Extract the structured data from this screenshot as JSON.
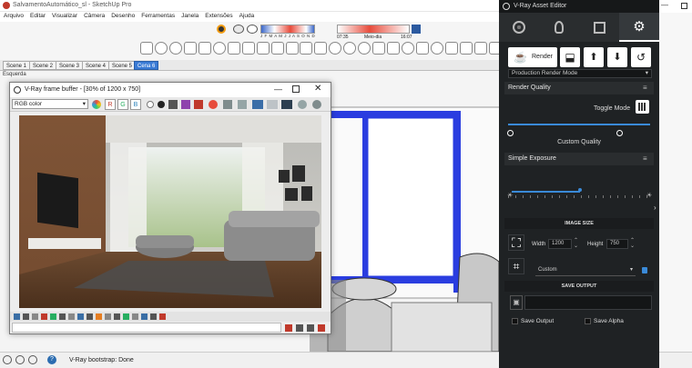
{
  "sketchup": {
    "title": "SalvamentoAutomático_sl - SketchUp Pro",
    "menu": [
      "Arquivo",
      "Editar",
      "Visualizar",
      "Câmera",
      "Desenho",
      "Ferramentas",
      "Janela",
      "Extensões",
      "Ajuda"
    ],
    "shadow_months": "J F M A M J J A S O N D",
    "time_start": "07:35",
    "time_mid": "Meio-dia",
    "time_end": "16:07",
    "scenes": [
      "Scene 1",
      "Scene 2",
      "Scene 3",
      "Scene 4",
      "Scene 5",
      "Cena 6"
    ],
    "active_scene": 5,
    "viewport_label": "Esquerda",
    "status_text": "V-Ray bootstrap: Done"
  },
  "frame_buffer": {
    "title": "V-Ray frame buffer - [30% of 1200 x 750]",
    "channel": "RGB color",
    "channel_letters": [
      "R",
      "G",
      "B"
    ]
  },
  "asset_editor": {
    "title": "V-Ray Asset Editor",
    "render_label": "Render",
    "render_mode": "Production Render Mode",
    "render_quality_label": "Render Quality",
    "toggle_mode_label": "Toggle Mode",
    "custom_quality_label": "Custom Quality",
    "quality_fraction": 0.78,
    "simple_exposure_label": "Simple Exposure",
    "exposure_fraction": 0.5,
    "image_size_label": "IMAGE SIZE",
    "width_label": "Width",
    "width_value": "1200",
    "height_label": "Height",
    "height_value": "750",
    "aspect_value": "Custom",
    "save_output_label": "SAVE OUTPUT",
    "save_output_check": "Save Output",
    "save_alpha_check": "Save Alpha",
    "accent": "#3a8ad8"
  }
}
